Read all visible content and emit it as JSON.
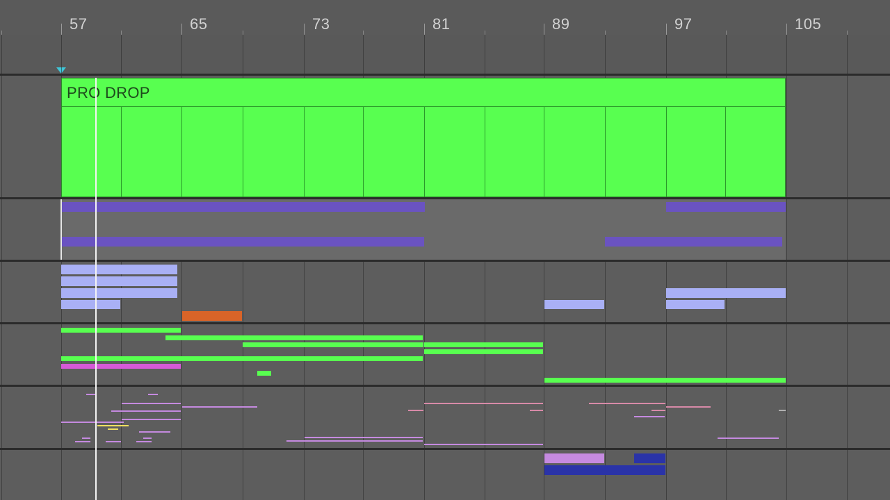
{
  "ruler": {
    "bar_numbers": [
      "57",
      "65",
      "73",
      "81",
      "89",
      "97",
      "105"
    ]
  },
  "clip": {
    "title": "PRO DROP",
    "color": "#58ff50"
  },
  "colors": {
    "playhead": "#f4f4f4",
    "start_marker": "#3fc6d8",
    "pad_purple": "#6a4fd0",
    "lavender": "#a9b0f5",
    "orange": "#d96428",
    "green": "#58ff50",
    "magenta": "#d65ad8",
    "navy": "#2a33a8",
    "orchid": "#c58ae0"
  },
  "icons": {
    "start_marker": "triangle-down-icon"
  }
}
